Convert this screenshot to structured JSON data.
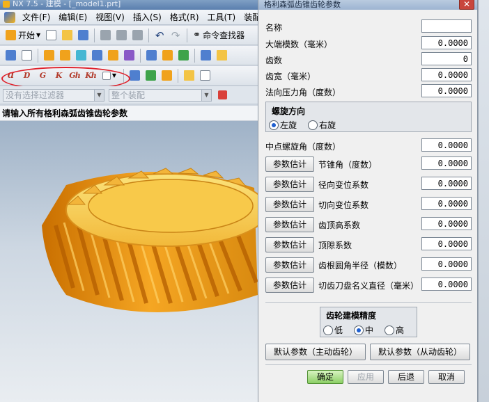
{
  "app": {
    "title": "NX 7.5 - 建模 - [_model1.prt]"
  },
  "menu": {
    "items": [
      "文件(F)",
      "编辑(E)",
      "视图(V)",
      "插入(S)",
      "格式(R)",
      "工具(T)",
      "装配(A)"
    ]
  },
  "toolbar": {
    "start_label": "开始",
    "command_finder_label": "命令查找器"
  },
  "filter": {
    "selection_filter": "没有选择过滤器",
    "scope": "整个装配"
  },
  "prompt": {
    "text": "请输入所有格利森弧齿锥齿轮参数"
  },
  "dialog": {
    "title": "格利森弧齿锥齿轮参数",
    "close_glyph": "✕",
    "fields": {
      "name_label": "名称",
      "name_value": "",
      "module_label": "大端模数（毫米）",
      "module_value": "0.0000",
      "teeth_label": "齿数",
      "teeth_value": "0",
      "face_width_label": "齿宽（毫米）",
      "face_width_value": "0.0000",
      "pressure_angle_label": "法向压力角（度数）",
      "pressure_angle_value": "0.0000",
      "spiral_angle_label": "中点螺旋角（度数）",
      "spiral_angle_value": "0.0000"
    },
    "helix": {
      "title": "螺旋方向",
      "left": "左旋",
      "right": "右旋",
      "selected": "left"
    },
    "estimate_button": "参数估计",
    "estimates": [
      {
        "label": "节锥角（度数）",
        "value": "0.0000"
      },
      {
        "label": "径向变位系数",
        "value": "0.0000"
      },
      {
        "label": "切向变位系数",
        "value": "0.0000"
      },
      {
        "label": "齿顶高系数",
        "value": "0.0000"
      },
      {
        "label": "顶隙系数",
        "value": "0.0000"
      },
      {
        "label": "齿根圆角半径（模数）",
        "value": "0.0000"
      },
      {
        "label": "切齿刀盘名义直径（毫米）",
        "value": "0.0000"
      }
    ],
    "precision": {
      "title": "齿轮建模精度",
      "low": "低",
      "mid": "中",
      "high": "高",
      "selected": "mid"
    },
    "defaults": {
      "driving": "默认参数（主动齿轮）",
      "driven": "默认参数（从动齿轮）"
    },
    "buttons": {
      "ok": "确定",
      "apply": "应用",
      "back": "后退",
      "cancel": "取消"
    }
  },
  "colors": {
    "gear_body": "#f0a020",
    "ok_button": "#8ccf65",
    "annotation_red": "#e0202a"
  }
}
